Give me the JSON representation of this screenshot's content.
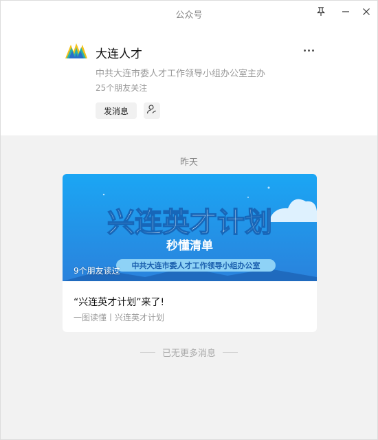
{
  "window": {
    "title": "公众号"
  },
  "account": {
    "name": "大连人才",
    "description": "中共大连市委人才工作领导小组办公室主办",
    "followers": "25个朋友关注",
    "send_message_label": "发消息"
  },
  "feed": {
    "date_separator": "昨天",
    "article": {
      "cover_title": "兴连英才计划",
      "cover_subtitle": "秒懂清单",
      "cover_org": "中共大连市委人才工作领导小组办公室",
      "friends_read": "9个朋友读过",
      "title": "“兴连英才计划”来了!",
      "subtitle": "一图读懂丨兴连英才计划"
    },
    "end_note": "已无更多消息"
  },
  "colors": {
    "cover_top": "#1b9ef0",
    "cover_bottom": "#2a7fd6",
    "feed_bg": "#f2f2f2"
  }
}
